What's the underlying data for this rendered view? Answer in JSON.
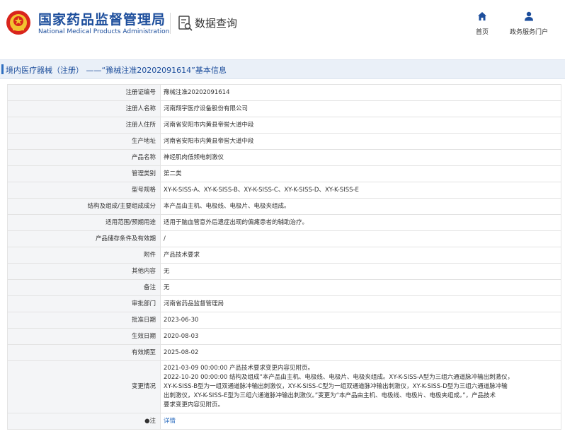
{
  "header": {
    "org_name_cn": "国家药品监督管理局",
    "org_name_en": "National Medical Products Administration",
    "query_title": "数据查询",
    "nav": {
      "home_label": "首页",
      "portal_label": "政务服务门户"
    }
  },
  "breadcrumb": {
    "text": "境内医疗器械（注册） ——“豫械注准20202091614”基本信息"
  },
  "rows": [
    {
      "label": "注册证编号",
      "value": "豫械注准20202091614"
    },
    {
      "label": "注册人名称",
      "value": "河南翔宇医疗设备股份有限公司"
    },
    {
      "label": "注册人住所",
      "value": "河南省安阳市内黄县帝喾大道中段"
    },
    {
      "label": "生产地址",
      "value": "河南省安阳市内黄县帝喾大道中段"
    },
    {
      "label": "产品名称",
      "value": "神经肌肉低频电刺激仪"
    },
    {
      "label": "管理类别",
      "value": "第二类"
    },
    {
      "label": "型号规格",
      "value": "XY-K-SISS-A、XY-K-SISS-B、XY-K-SISS-C、XY-K-SISS-D、XY-K-SISS-E"
    },
    {
      "label": "结构及组成/主要组成成分",
      "value": "本产品由主机、电极线、电极片、电极夹组成。"
    },
    {
      "label": "适用范围/预期用途",
      "value": "适用于脑血管意外后遗症出现的偏瘫患者的辅助治疗。"
    },
    {
      "label": "产品储存条件及有效期",
      "value": "/"
    },
    {
      "label": "附件",
      "value": "产品技术要求"
    },
    {
      "label": "其他内容",
      "value": "无"
    },
    {
      "label": "备注",
      "value": "无"
    },
    {
      "label": "审批部门",
      "value": "河南省药品监督管理局"
    },
    {
      "label": "批准日期",
      "value": "2023-06-30"
    },
    {
      "label": "生效日期",
      "value": "2020-08-03"
    },
    {
      "label": "有效期至",
      "value": "2025-08-02"
    }
  ],
  "change": {
    "label": "变更情况",
    "lines": [
      "2021-03-09 00:00:00 产品技术要求变更内容见附页。",
      "2022-10-20 00:00:00 结构及组成“本产品由主机、电极线、电极片、电极夹组成。XY-K-SISS-A型为三组六通道脉冲输出刺激仪，",
      "XY-K-SISS-B型为一组双通道脉冲输出刺激仪，XY-K-SISS-C型为一组双通道脉冲输出刺激仪，XY-K-SISS-D型为三组六通道脉冲输",
      "出刺激仪，XY-K-SISS-E型为三组六通道脉冲输出刺激仪。”变更为“本产品由主机、电极线、电极片、电极夹组成。”，产品技术",
      "要求变更内容见附页。"
    ]
  },
  "note": {
    "label": "●注",
    "link_text": "详情"
  }
}
